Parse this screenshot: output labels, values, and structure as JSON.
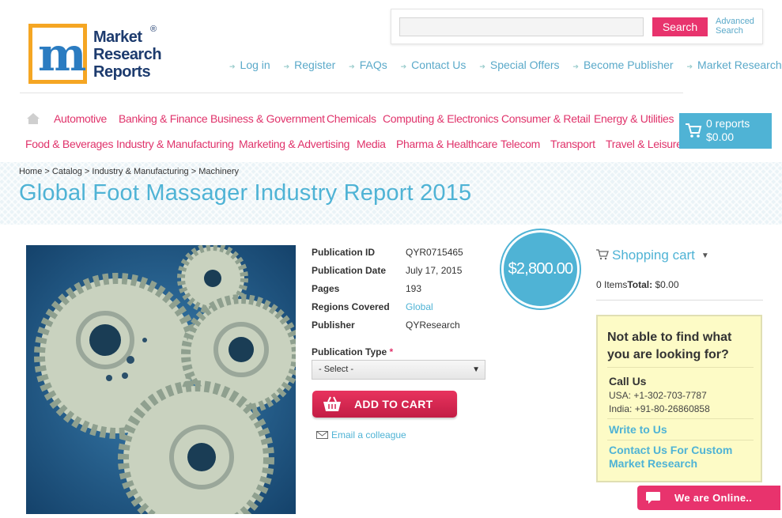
{
  "logo": {
    "line1": "Market",
    "line2": "Research",
    "line3": "Reports",
    "reg": "®"
  },
  "search": {
    "placeholder": "",
    "button": "Search",
    "advanced_line1": "Advanced",
    "advanced_line2": "Search"
  },
  "top_links": [
    "Log in",
    "Register",
    "FAQs",
    "Contact Us",
    "Special Offers",
    "Become Publisher",
    "Market Research Blog"
  ],
  "nav": {
    "row1": [
      "Automotive",
      "Banking & Finance",
      "Business & Government",
      "Chemicals",
      "Computing & Electronics",
      "Consumer & Retail",
      "Energy & Utilities"
    ],
    "row2": [
      "Food & Beverages",
      "Industry & Manufacturing",
      "Marketing & Advertising",
      "Media",
      "Pharma & Healthcare",
      "Telecom",
      "Transport",
      "Travel & Leisure"
    ]
  },
  "cart": {
    "count": "0 reports",
    "total": "$0.00"
  },
  "breadcrumb": {
    "home": "Home",
    "catalog": "Catalog",
    "category": "Industry & Manufacturing",
    "sub": "Machinery",
    "sep": ">"
  },
  "title": "Global Foot Massager Industry Report 2015",
  "details": {
    "publication_id_label": "Publication ID",
    "publication_id": "QYR0715465",
    "publication_date_label": "Publication Date",
    "publication_date": "July 17, 2015",
    "pages_label": "Pages",
    "pages": "193",
    "regions_label": "Regions Covered",
    "regions": "Global",
    "publisher_label": "Publisher",
    "publisher": "QYResearch"
  },
  "price": "$2,800.00",
  "publication_type": {
    "label": "Publication Type",
    "required": "*",
    "selected": "- Select -"
  },
  "add_to_cart": "ADD TO CART",
  "email_colleague": "Email a colleague",
  "shopping_cart": {
    "title": "Shopping cart",
    "items": "0 Items",
    "total_label": "Total:",
    "total": "$0.00"
  },
  "help": {
    "title": "Not able to find what you are looking for?",
    "call_us": "Call Us",
    "usa": "USA: +1-302-703-7787",
    "india": "India: +91-80-26860858",
    "write": "Write to Us",
    "custom": "Contact Us For Custom Market Research"
  },
  "chat": "We are Online..",
  "colors": {
    "accent_pink": "#e0336b",
    "accent_blue": "#4fb3d5",
    "logo_orange": "#f5a623"
  }
}
